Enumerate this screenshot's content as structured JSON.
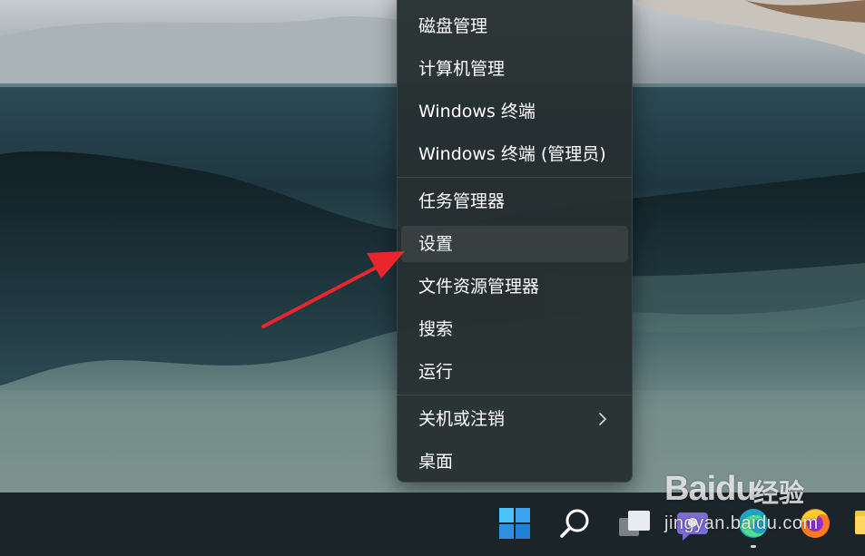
{
  "context_menu": {
    "items": [
      {
        "label": "磁盘管理"
      },
      {
        "label": "计算机管理"
      },
      {
        "label": "Windows 终端"
      },
      {
        "label": "Windows 终端 (管理员)"
      },
      {
        "label": "任务管理器"
      },
      {
        "label": "设置",
        "highlighted": true
      },
      {
        "label": "文件资源管理器"
      },
      {
        "label": "搜索"
      },
      {
        "label": "运行"
      },
      {
        "label": "关机或注销",
        "has_submenu": true,
        "submenu_icon": "chevron-right-icon"
      },
      {
        "label": "桌面"
      }
    ]
  },
  "annotation": {
    "type": "red-arrow",
    "points_to": "设置",
    "color": "#e8262b"
  },
  "taskbar": {
    "icons": [
      "windows-start-icon",
      "search-icon",
      "task-view-icon",
      "chat-icon",
      "edge-icon",
      "firefox-icon",
      "file-explorer-icon"
    ],
    "colors": {
      "start": "#3aa4f0",
      "edge": "#1fa3c9",
      "firefox": "#ff7a1f"
    }
  },
  "watermark": {
    "logo": "Bai",
    "logo_suffix": "du",
    "product": "经验",
    "url": "jingyan.baidu.com"
  }
}
